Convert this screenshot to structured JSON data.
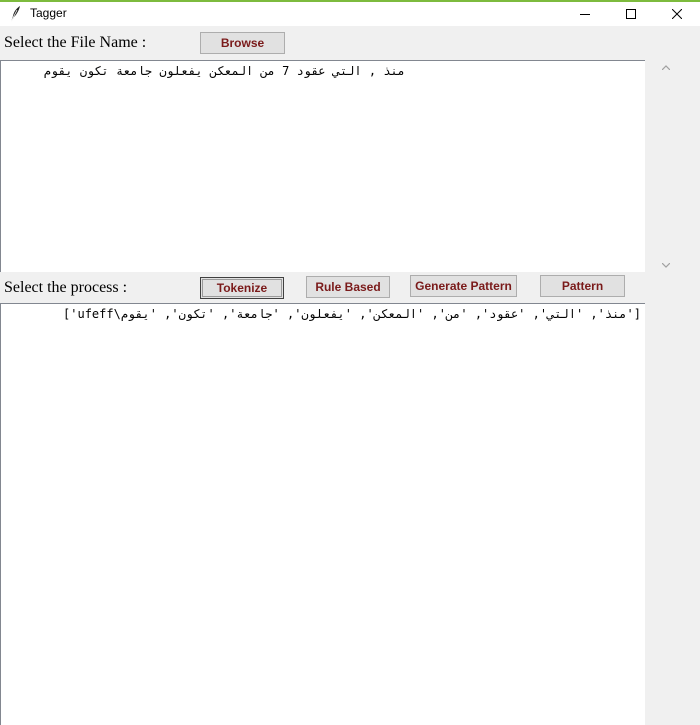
{
  "window": {
    "title": "Tagger",
    "icon": "feather-icon",
    "controls": [
      "minimize-icon",
      "maximize-icon",
      "close-icon"
    ]
  },
  "file_section": {
    "label": "Select the File Name :",
    "browse_label": "Browse",
    "content": "منذ , التي عقود 7 من المعكن يفعلون جامعة تكون يقوم"
  },
  "process_section": {
    "label": "Select the process :",
    "buttons": {
      "tokenize": "Tokenize",
      "rule_based": "Rule Based",
      "generate_pattern": "Generate Pattern",
      "pattern": "Pattern"
    },
    "output": "['منذ', 'التي', 'عقود', 'من', 'المعكن', 'يفعلون', 'جامعة', 'تكون', 'يقوم\\ufeff']"
  },
  "colors": {
    "accent_bar": "#7dbb3d",
    "button_text": "#7a1a1a",
    "window_bg": "#f0f0f0"
  }
}
